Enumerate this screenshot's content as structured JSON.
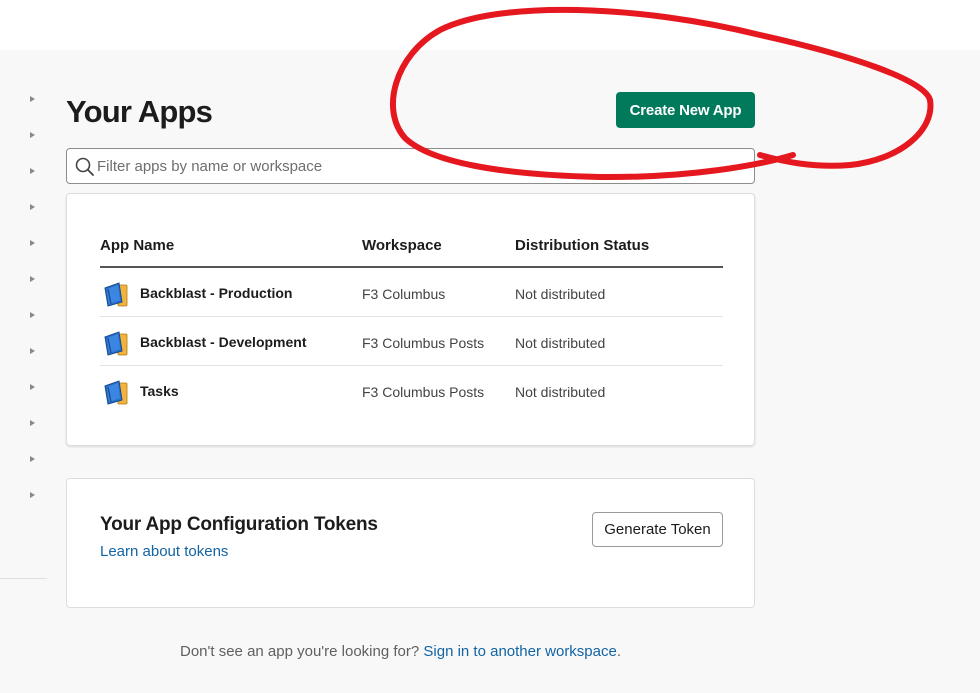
{
  "page": {
    "title": "Your Apps"
  },
  "toolbar": {
    "create_label": "Create New App"
  },
  "search": {
    "placeholder": "Filter apps by name or workspace",
    "value": ""
  },
  "apps_table": {
    "headers": {
      "name": "App Name",
      "workspace": "Workspace",
      "status": "Distribution Status"
    },
    "rows": [
      {
        "name": "Backblast - Production",
        "workspace": "F3 Columbus",
        "status": "Not distributed"
      },
      {
        "name": "Backblast - Development",
        "workspace": "F3 Columbus Posts",
        "status": "Not distributed"
      },
      {
        "name": "Tasks",
        "workspace": "F3 Columbus Posts",
        "status": "Not distributed"
      }
    ],
    "icon": "app-book-icon"
  },
  "tokens": {
    "title": "Your App Configuration Tokens",
    "link": "Learn about tokens",
    "button": "Generate Token"
  },
  "footer": {
    "text": "Don't see an app you're looking for?",
    "link": "Sign in to another workspace",
    "end": "."
  },
  "colors": {
    "primary": "#007a5a",
    "link": "#1264a3",
    "annotation": "#e5181f"
  },
  "icons": {
    "search": "search-icon",
    "sidebar_item": "caret-right-icon",
    "annotation": "red-circle-annotation"
  }
}
